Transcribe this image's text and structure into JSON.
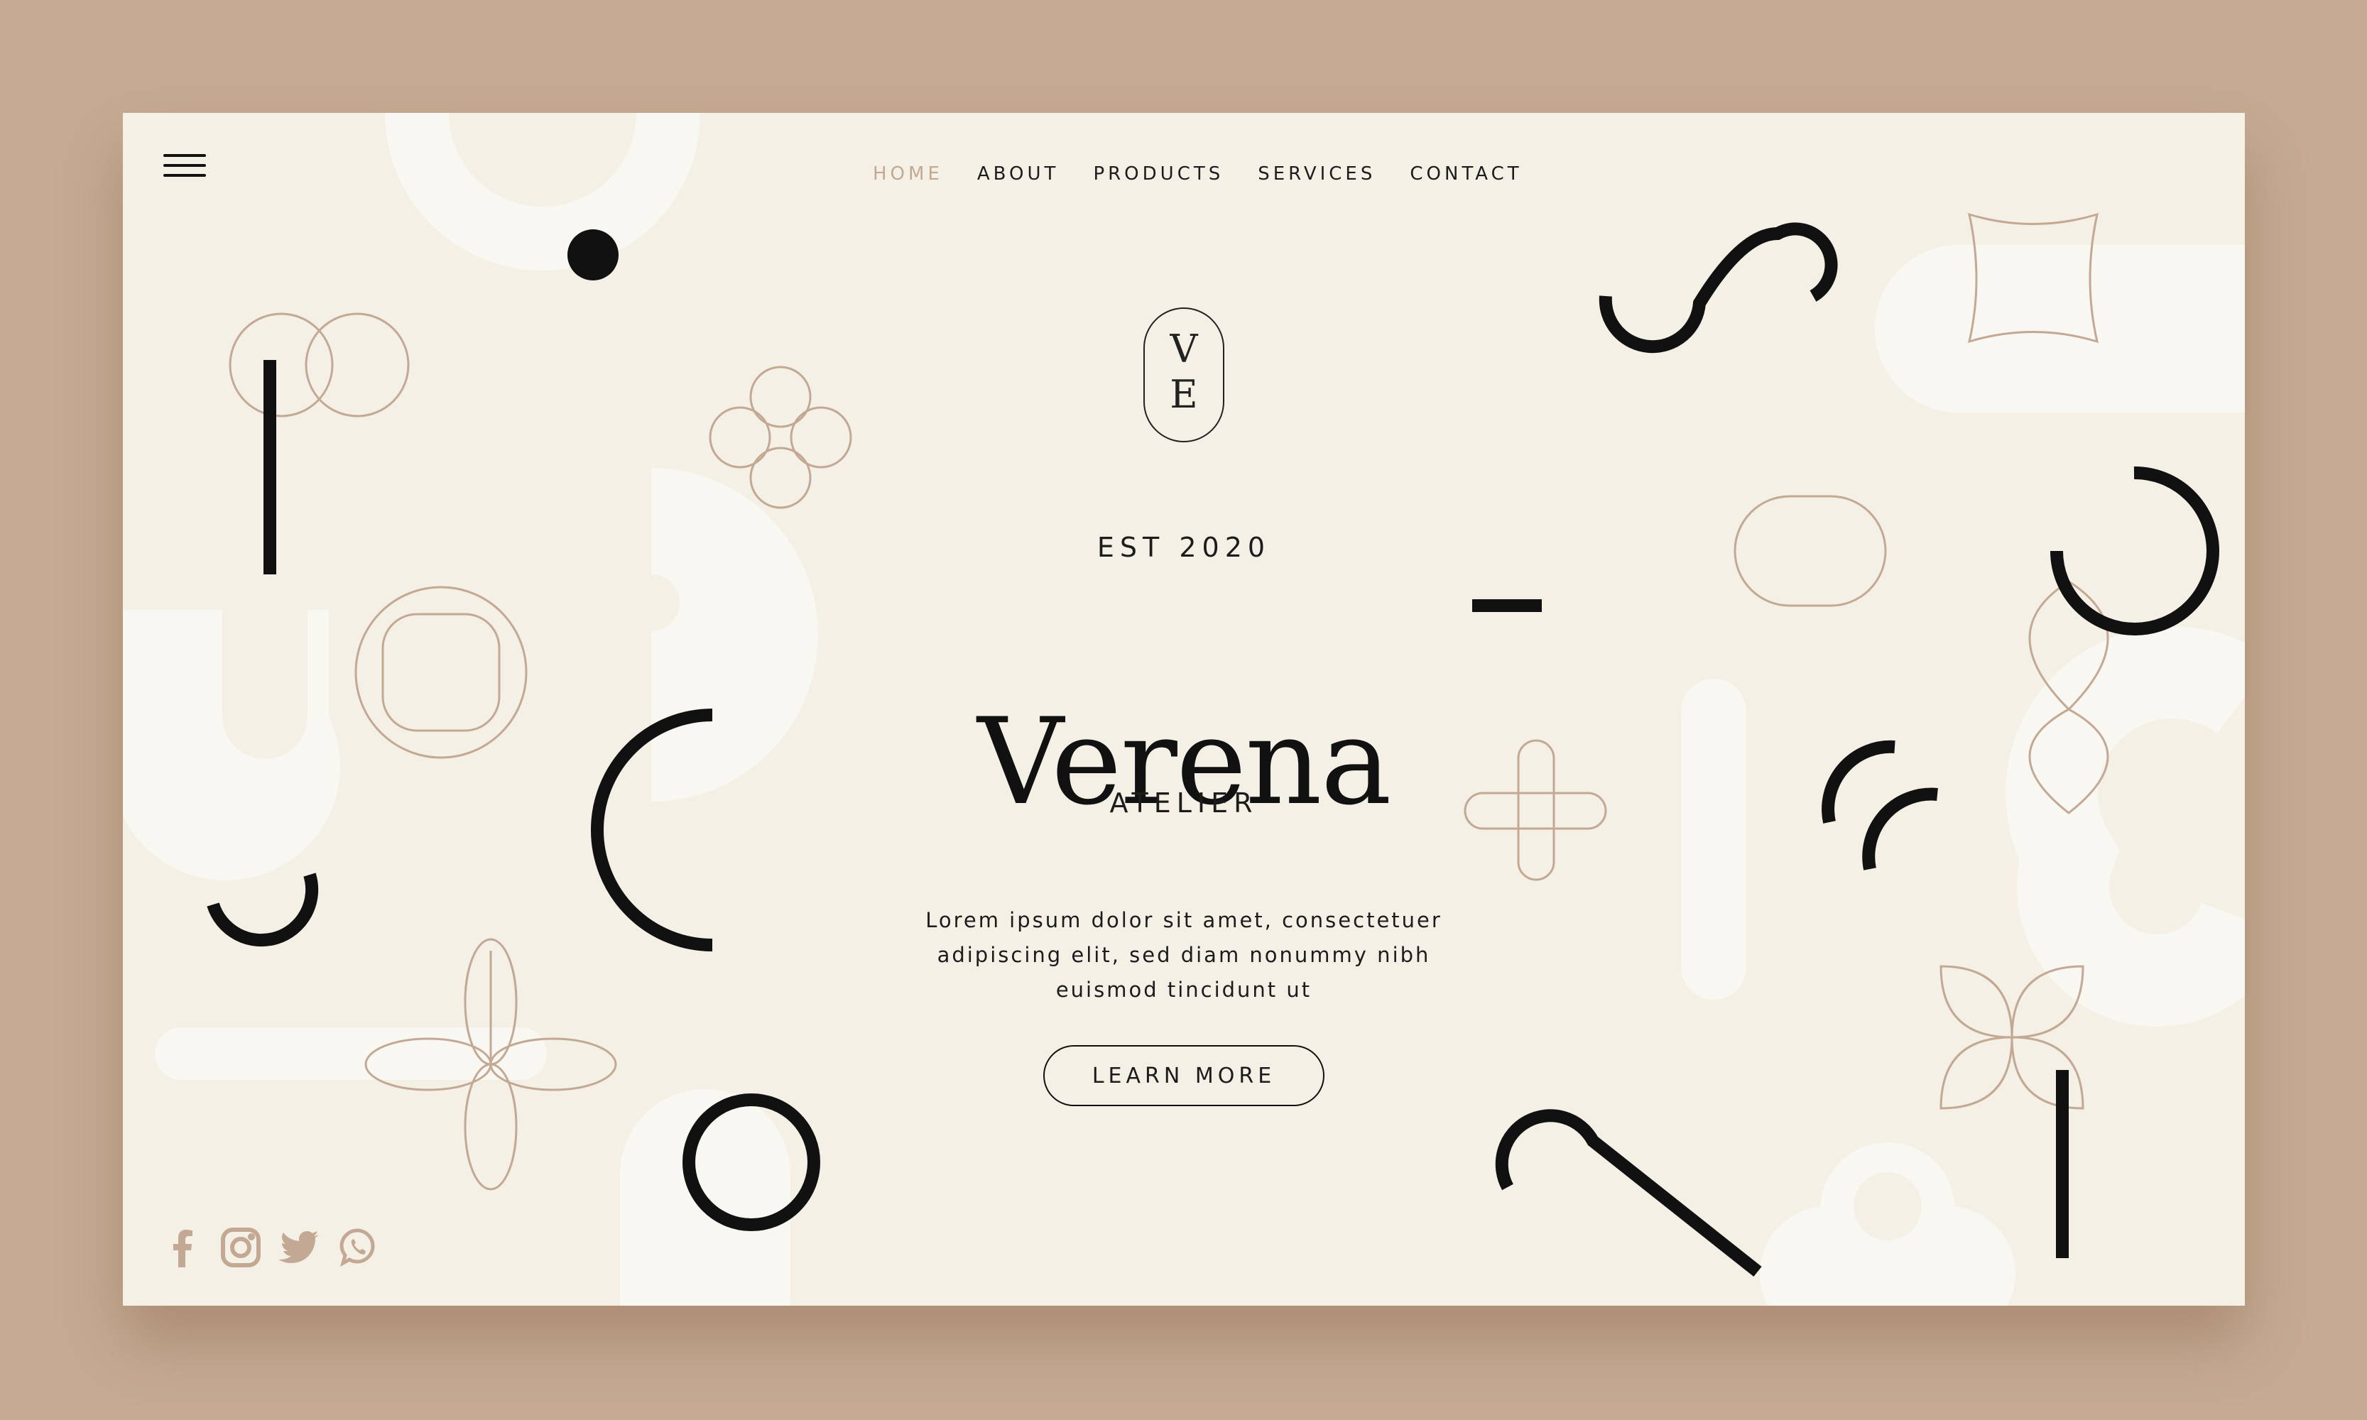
{
  "nav": {
    "items": [
      {
        "label": "HOME",
        "active": true
      },
      {
        "label": "ABOUT",
        "active": false
      },
      {
        "label": "PRODUCTS",
        "active": false
      },
      {
        "label": "SERVICES",
        "active": false
      },
      {
        "label": "CONTACT",
        "active": false
      }
    ]
  },
  "hero": {
    "monogram_top": "V",
    "monogram_bottom": "E",
    "established": "EST 2020",
    "brand": "Verena",
    "subtitle": "ATELIER",
    "description_lines": [
      "Lorem ipsum dolor sit amet, consectetuer",
      "adipiscing elit, sed diam nonummy nibh",
      "euismod tincidunt ut"
    ],
    "cta_label": "LEARN MORE"
  },
  "social": {
    "icons": [
      "facebook-icon",
      "instagram-icon",
      "twitter-icon",
      "whatsapp-icon"
    ]
  },
  "colors": {
    "page_background": "#c6aa93",
    "card_background": "#f4f0e5",
    "accent": "#c3a994",
    "ink": "#111111",
    "soft_white": "#f9f7f2"
  }
}
